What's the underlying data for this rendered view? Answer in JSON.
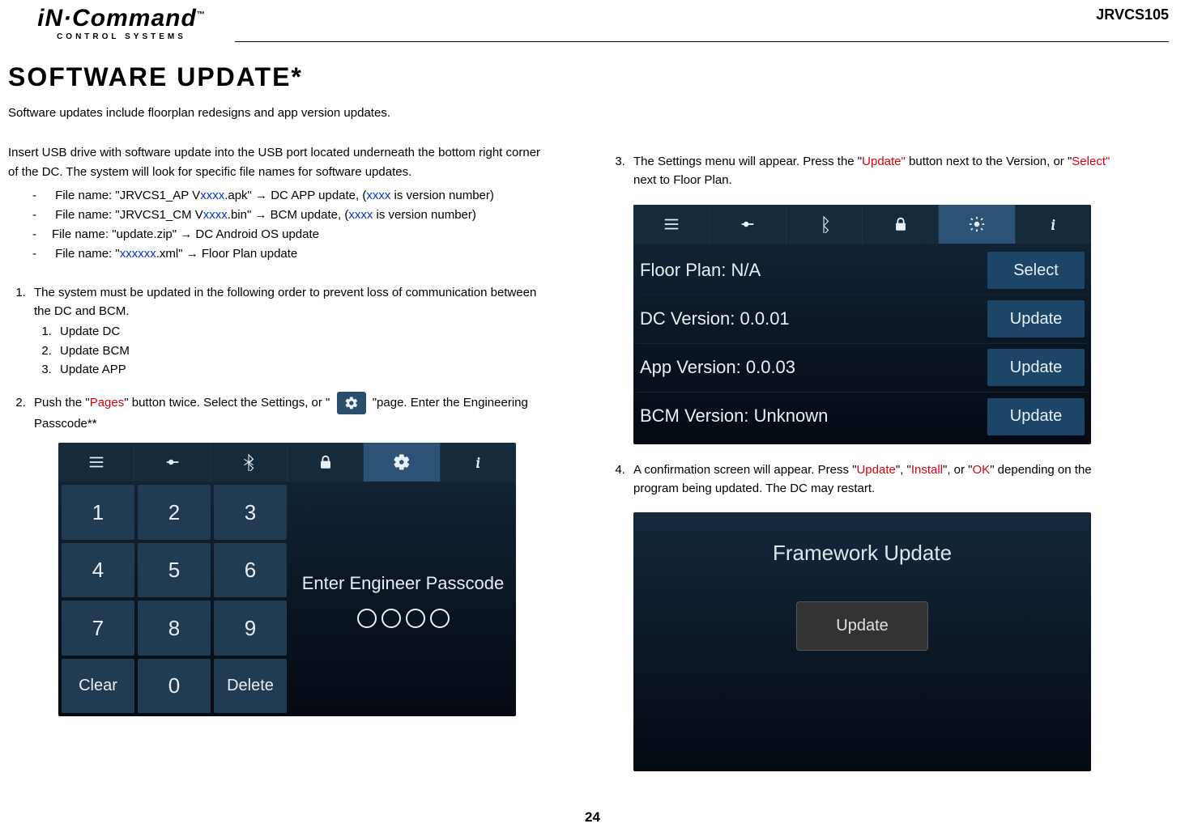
{
  "header": {
    "logo_main": "iN·Command",
    "logo_sub": "CONTROL SYSTEMS",
    "model": "JRVCS105"
  },
  "title": "SOFTWARE UPDATE*",
  "intro": "Software updates include floorplan redesigns and app version updates.",
  "insert_text": "Insert USB drive with software update into the USB port located underneath the bottom right corner of the DC. The system will look for specific file names for software updates.",
  "files": {
    "f1_pre": "File name: \"JRVCS1_AP V",
    "f1_mid": "xxxx",
    "f1_post": ".apk\"    → DC APP update, (",
    "f1_post2": "xxxx",
    "f1_post3": " is version number)",
    "f2_pre": "File name: \"JRVCS1_CM V",
    "f2_mid": "xxxx",
    "f2_post": ".bin\"    → BCM update, (",
    "f2_post2": "xxxx",
    "f2_post3": " is version number)",
    "f3": "File name: \"update.zip\"    → DC Android OS update",
    "f4_pre": "File name: \"",
    "f4_mid": "xxxxxx",
    "f4_post": ".xml\"    → Floor Plan update"
  },
  "step1": "The system must be updated in the following order to prevent loss of communication between the DC and BCM.",
  "step1_sub": {
    "a": "Update DC",
    "b": "Update BCM",
    "c": "Update APP"
  },
  "step2_pre": "Push the \"",
  "step2_pages": "Pages",
  "step2_post": "\" button twice. Select the Settings, or \"",
  "step2_end": "\"page. Enter the Engineering Passcode**",
  "keypad": {
    "k1": "1",
    "k2": "2",
    "k3": "3",
    "k4": "4",
    "k5": "5",
    "k6": "6",
    "k7": "7",
    "k8": "8",
    "k9": "9",
    "kc": "Clear",
    "k0": "0",
    "kd": "Delete",
    "prompt": "Enter Engineer Passcode"
  },
  "step3_pre": "The Settings menu will appear. Press the \"",
  "step3_update": "Update\"",
  "step3_mid": " button next to the Version, or \"",
  "step3_select": "Select\"",
  "step3_post": " next to Floor Plan.",
  "settings": {
    "rows": [
      {
        "label": "Floor Plan:  N/A",
        "action": "Select"
      },
      {
        "label": "DC Version:  0.0.01",
        "action": "Update"
      },
      {
        "label": "App Version:  0.0.03",
        "action": "Update"
      },
      {
        "label": "BCM Version:  Unknown",
        "action": "Update"
      }
    ]
  },
  "step4_pre": "A confirmation screen will appear. Press \"",
  "step4_a": "Update",
  "step4_mid1": "\", \"",
  "step4_b": "Install",
  "step4_mid2": "\", or \"",
  "step4_c": "OK",
  "step4_post": "\" depending on the program being updated. The DC may restart.",
  "fw": {
    "title": "Framework Update",
    "btn": "Update"
  },
  "page_number": "24"
}
